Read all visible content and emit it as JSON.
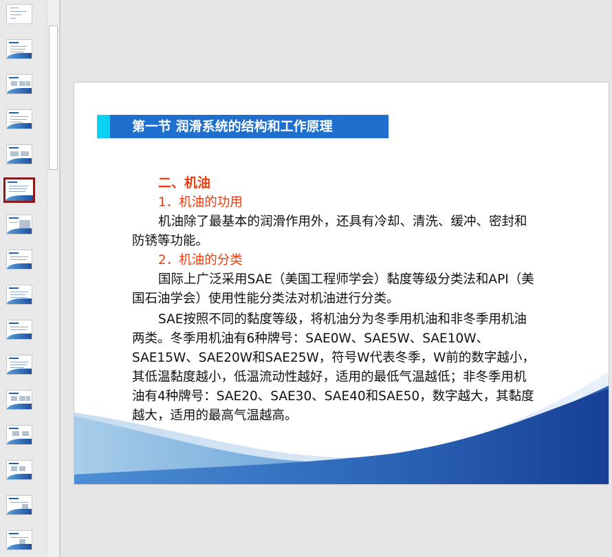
{
  "thumbnails": {
    "count": 16,
    "selected_index": 5
  },
  "slide": {
    "title": "第一节  润滑系统的结构和工作原理",
    "section_heading": "二、机油",
    "sub1": "1．机油的功用",
    "para1_l1": "机油除了最基本的润滑作用外，还具有冷却、清洗、缓冲、密封和",
    "para1_l2": "防锈等功能。",
    "sub2": "2．机油的分类",
    "para2_l1": "国际上广泛采用SAE（美国工程师学会）黏度等级分类法和API（美",
    "para2_l2": "国石油学会）使用性能分类法对机油进行分类。",
    "para3_l1": "SAE按照不同的黏度等级，将机油分为冬季用机油和非冬季用机油",
    "para3_l2": "两类。冬季用机油有6种牌号：SAE0W、SAE5W、SAE10W、",
    "para3_l3": "SAE15W、SAE20W和SAE25W，符号W代表冬季，W前的数字越小，",
    "para3_l4": "其低温黏度越小，低温流动性越好，适用的最低气温越低；非冬季用机",
    "para3_l5": "油有4种牌号：SAE20、SAE30、SAE40和SAE50，数字越大，其黏度",
    "para3_l6": "越大，适用的最高气温越高。"
  },
  "colors": {
    "title_bar": "#1f6fce",
    "title_accent": "#0ad0f2",
    "heading_red": "#ee3b0f",
    "selected_border": "#8b1a1a"
  }
}
